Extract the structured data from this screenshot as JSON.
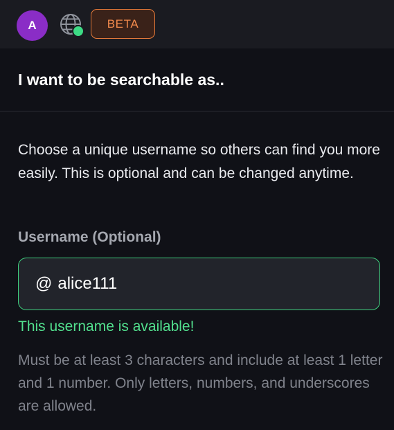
{
  "header": {
    "avatar_initial": "A",
    "badge_label": "BETA",
    "globe_icon": "globe-icon",
    "online_status_color": "#3ddb85"
  },
  "main": {
    "title": "I want to be searchable as..",
    "description": "Choose a unique username so others can find you more easily. This is optional and can be changed anytime.",
    "username_field": {
      "label": "Username (Optional)",
      "prefix": "@",
      "value": "alice111",
      "status": "This username is available!",
      "hint": "Must be at least 3 characters and include at least 1 letter and 1 number. Only letters, numbers, and underscores are allowed."
    }
  },
  "colors": {
    "avatar": "#8a2dc6",
    "badge_border": "#e57a3a",
    "success": "#3fcf7e",
    "background": "#101117"
  }
}
